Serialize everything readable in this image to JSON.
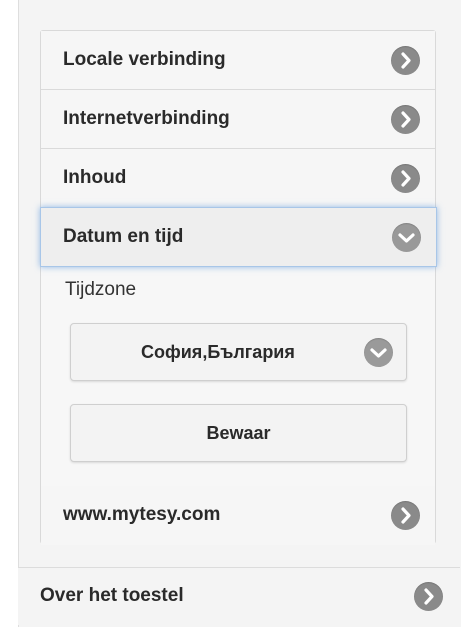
{
  "menu": {
    "items": [
      {
        "label": "Locale verbinding",
        "icon": "chevron-right-icon"
      },
      {
        "label": "Internetverbinding",
        "icon": "chevron-right-icon"
      },
      {
        "label": "Inhoud",
        "icon": "chevron-right-icon"
      },
      {
        "label": "Datum en tijd",
        "icon": "chevron-down-icon",
        "expanded": true
      }
    ],
    "last_item": {
      "label": "www.mytesy.com",
      "icon": "chevron-right-icon"
    }
  },
  "date_time": {
    "timezone_label": "Tijdzone",
    "timezone_value": "София,България",
    "save_label": "Bewaar"
  },
  "outer": {
    "device_label": "Over het toestel"
  },
  "colors": {
    "icon_circle": "#8a8a8a",
    "active_glow": "#5a96dc",
    "panel_bg": "#f4f4f4"
  }
}
